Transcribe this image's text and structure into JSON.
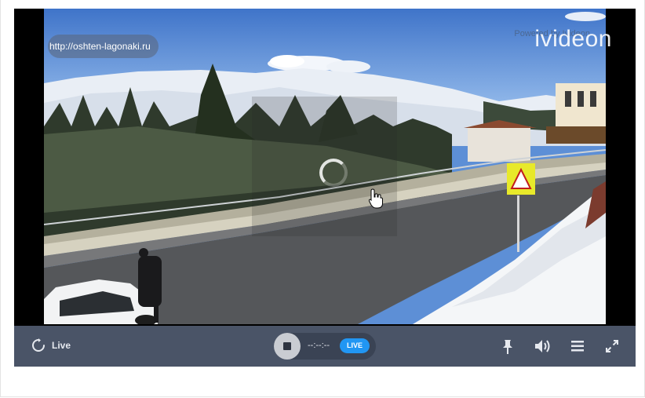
{
  "overlay": {
    "url_badge": "http://oshten-lagonaki.ru",
    "powered_by": "Powered by Ivideon",
    "brand": "ivideon"
  },
  "controls": {
    "live_label": "Live",
    "timecode": "--:--:--",
    "live_badge": "LIVE"
  },
  "colors": {
    "control_bar": "#4a5467",
    "live_badge": "#2196f3",
    "pill": "#3a4354"
  },
  "icons": {
    "refresh": "refresh-icon",
    "stop": "stop-icon",
    "pin": "pin-icon",
    "volume": "volume-icon",
    "menu": "menu-icon",
    "fullscreen": "fullscreen-icon"
  }
}
